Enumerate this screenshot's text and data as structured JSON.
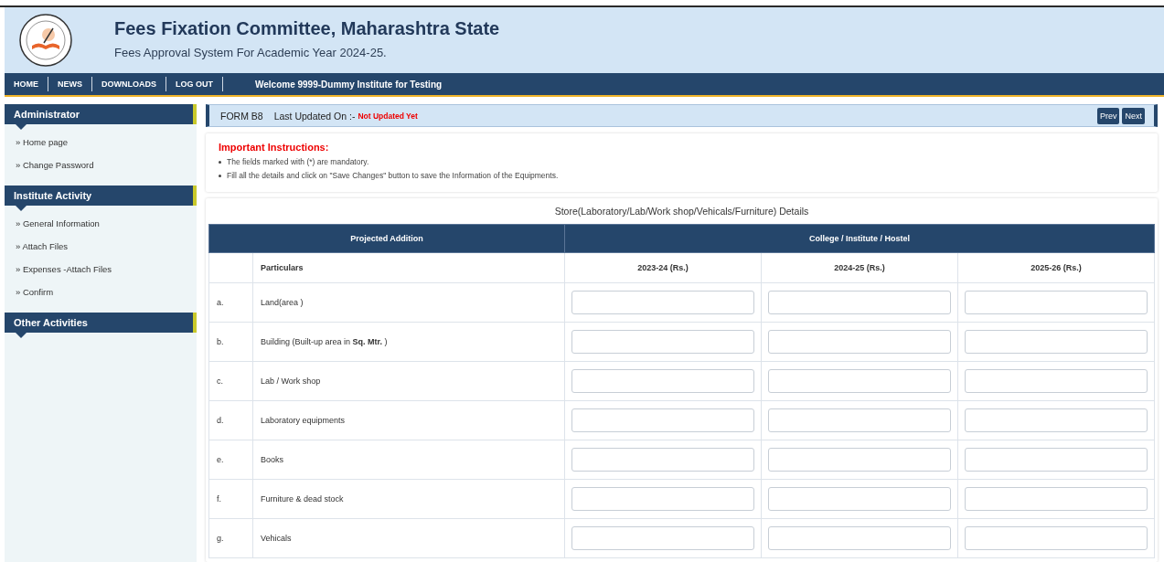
{
  "header": {
    "title": "Fees Fixation Committee, Maharashtra State",
    "subtitle": "Fees Approval System For Academic Year 2024-25."
  },
  "nav": {
    "links": [
      "HOME",
      "NEWS",
      "DOWNLOADS",
      "LOG OUT"
    ],
    "welcome": "Welcome 9999-Dummy Institute for Testing"
  },
  "sidebar": {
    "sections": [
      {
        "title": "Administrator",
        "items": [
          "» Home page",
          "» Change Password"
        ]
      },
      {
        "title": "Institute Activity",
        "items": [
          "» General Information",
          "» Attach Files",
          "» Expenses -Attach Files",
          "» Confirm"
        ]
      },
      {
        "title": "Other Activities"
      }
    ]
  },
  "form_bar": {
    "form": "FORM B8",
    "updated_label": "Last Updated On :-",
    "updated_value": "Not Updated Yet",
    "buttons": [
      "Prev",
      "Next"
    ]
  },
  "instructions": {
    "title": "Important Instructions:",
    "items": [
      "The fields marked with (*) are mandatory.",
      "Fill all the details and click on \"Save Changes\" button to save the Information of the Equipments."
    ]
  },
  "table": {
    "title": "Store(Laboratory/Lab/Work shop/Vehicals/Furniture) Details",
    "group_left": "Projected Addition",
    "group_right": "College / Institute / Hostel",
    "particulars_header": "Particulars",
    "year_columns": [
      "2023-24 (Rs.)",
      "2024-25 (Rs.)",
      "2025-26 (Rs.)"
    ],
    "rows": [
      {
        "index": "a.",
        "label": "Land(area )"
      },
      {
        "index": "b.",
        "label": "Building (Built-up area in **Sq. Mtr.** )"
      },
      {
        "index": "c.",
        "label": "Lab / Work shop"
      },
      {
        "index": "d.",
        "label": "Laboratory equipments"
      },
      {
        "index": "e.",
        "label": "Books"
      },
      {
        "index": "f.",
        "label": "Furniture & dead stock"
      },
      {
        "index": "g.",
        "label": "Vehicals"
      }
    ]
  }
}
